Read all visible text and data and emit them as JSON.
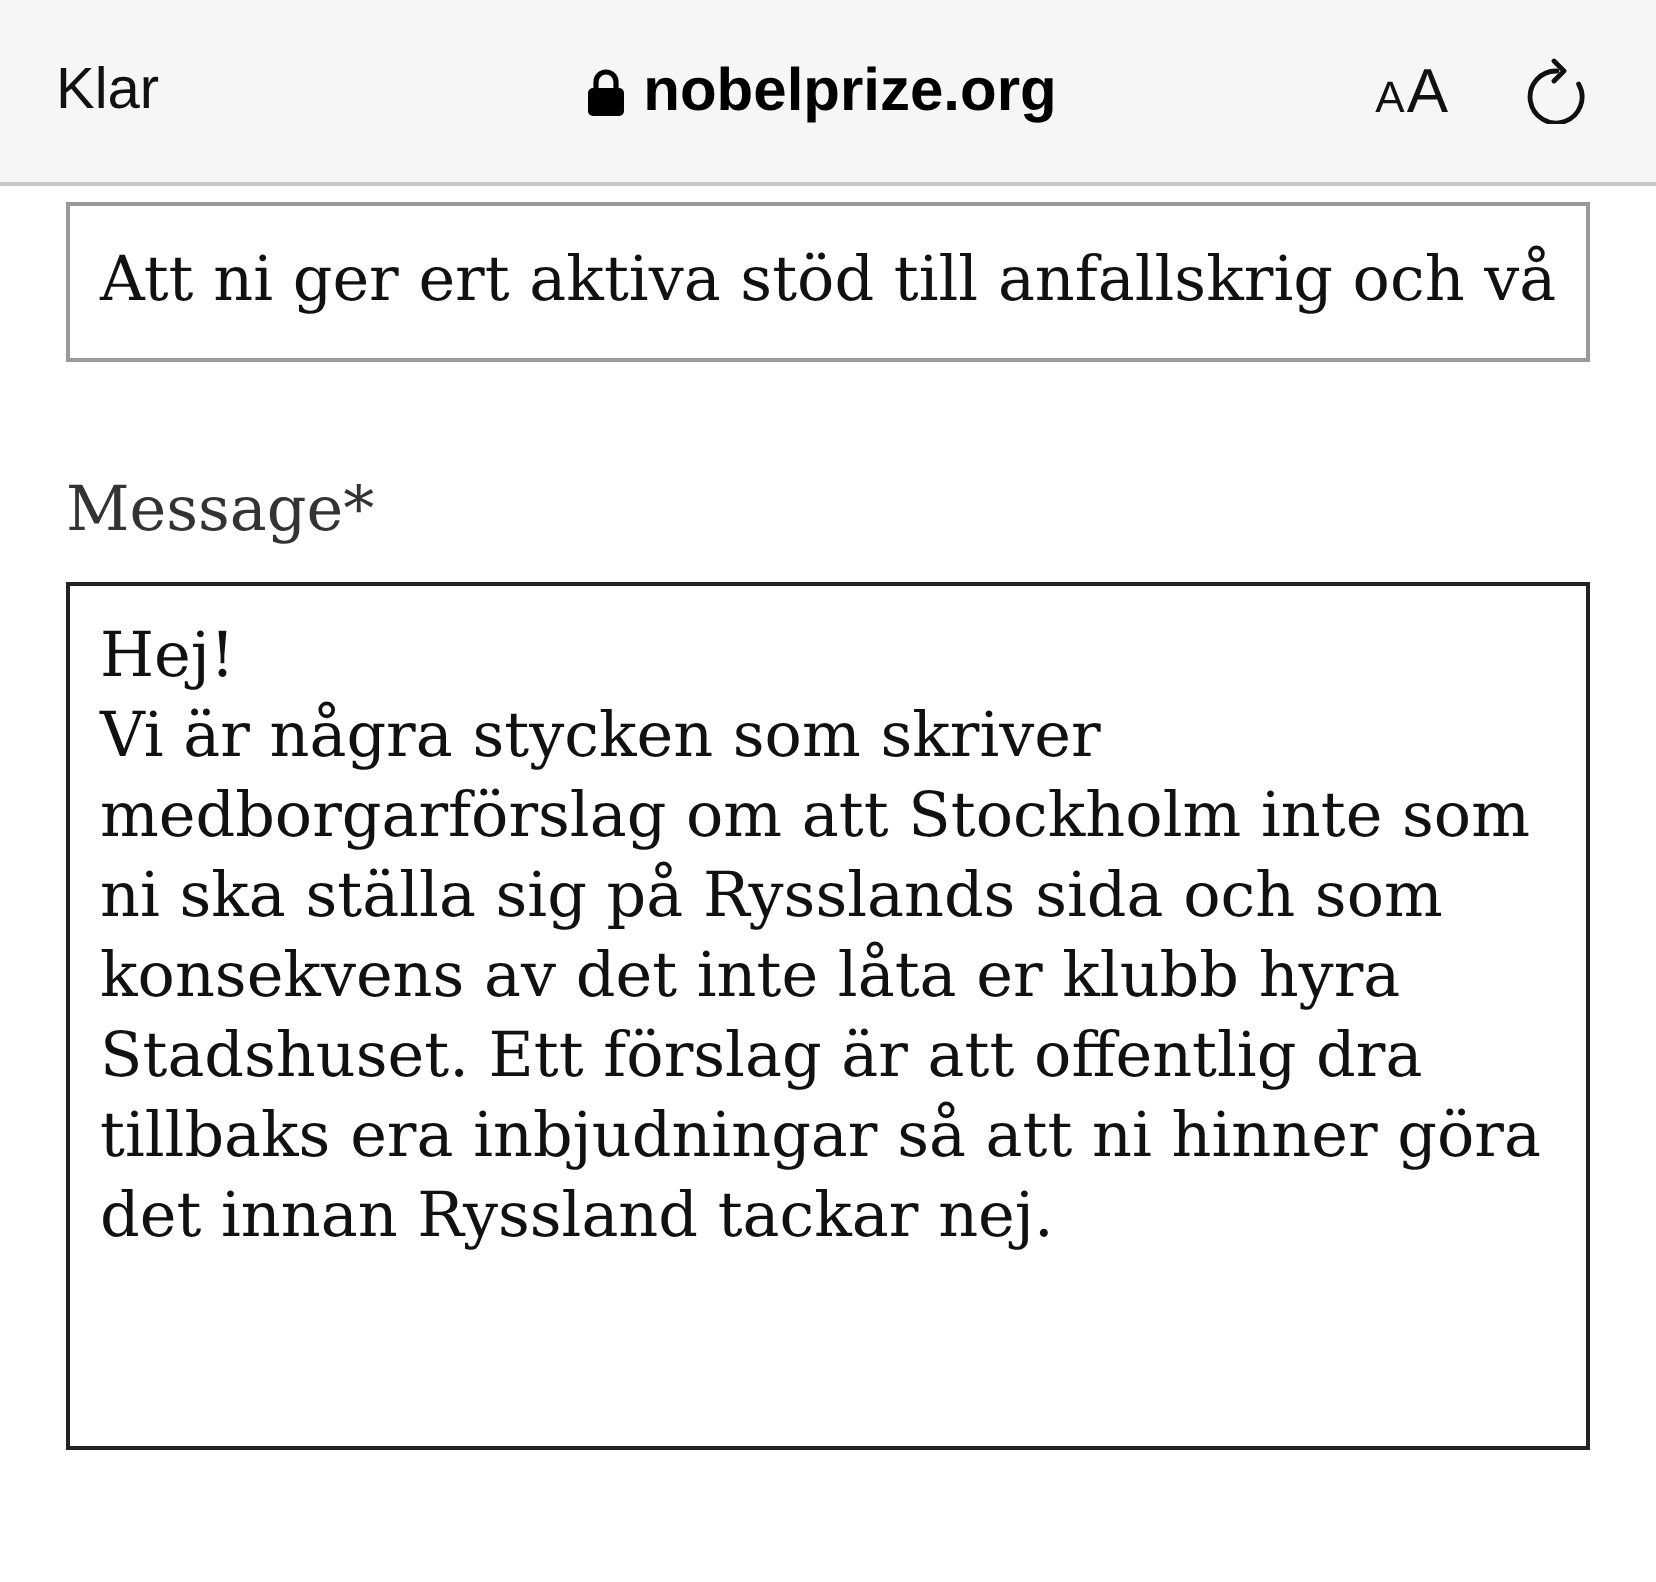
{
  "browser_bar": {
    "done_button": "Klar",
    "secure": true,
    "address": "nobelprize.org",
    "text_size_button": [
      "A",
      "A"
    ]
  },
  "form": {
    "subject_field": {
      "value": "Att ni ger ert aktiva stöd till anfallskrig och vå"
    },
    "message_field": {
      "label": "Message*",
      "value": "Hej!\nVi är några stycken som skriver medborgarförslag om att Stockholm inte som ni ska ställa sig på Rysslands sida och som konsekvens av det inte låta er klubb hyra Stadshuset. Ett förslag är att offentlig dra tillbaks era inbjudningar så att ni hinner göra det innan Ryssland tackar nej."
    }
  }
}
